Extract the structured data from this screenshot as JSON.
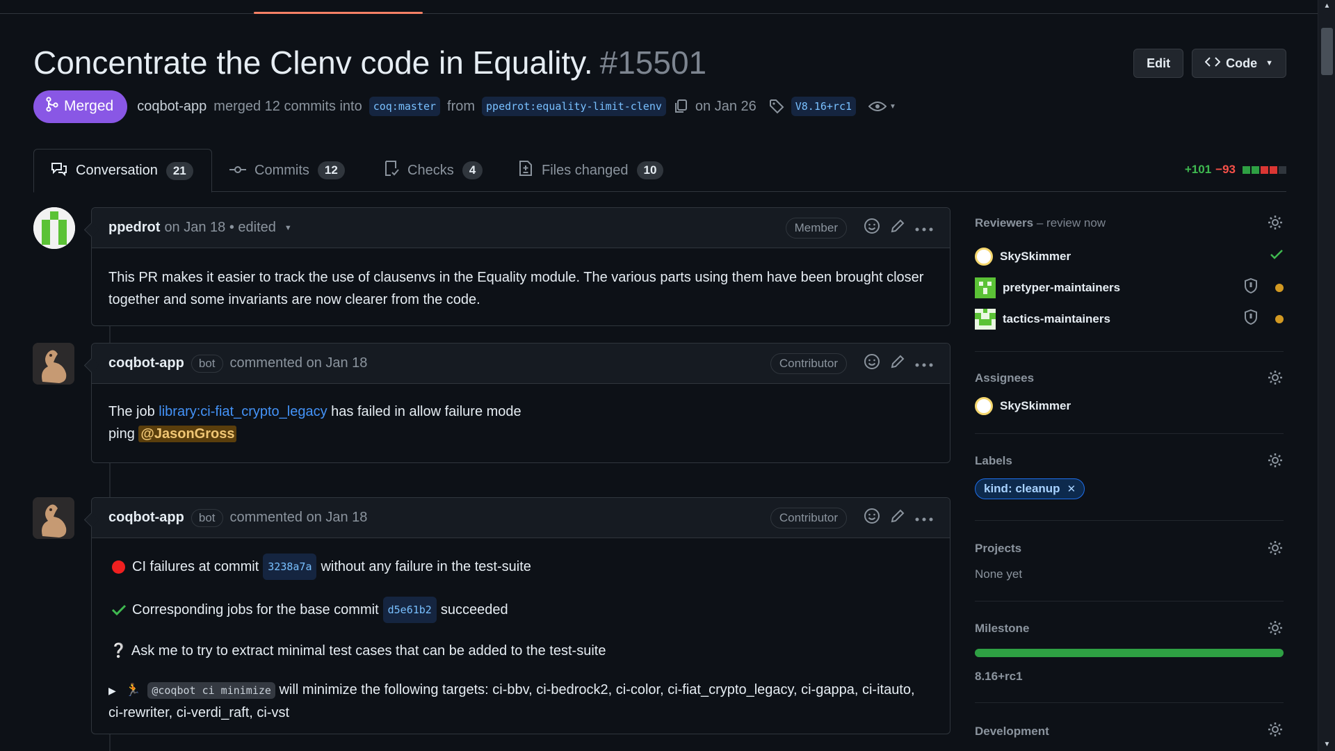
{
  "header": {
    "title": "Concentrate the Clenv code in Equality.",
    "number": "#15501",
    "edit_label": "Edit",
    "code_label": "Code"
  },
  "meta": {
    "status": "Merged",
    "author": "coqbot-app",
    "action": "merged 12 commits into",
    "base_branch": "coq:master",
    "from_word": "from",
    "head_branch": "ppedrot:equality-limit-clenv",
    "date": "on Jan 26",
    "tag": "V8.16+rc1"
  },
  "tabs": [
    {
      "label": "Conversation",
      "count": "21"
    },
    {
      "label": "Commits",
      "count": "12"
    },
    {
      "label": "Checks",
      "count": "4"
    },
    {
      "label": "Files changed",
      "count": "10"
    }
  ],
  "diffstat": {
    "additions": "+101",
    "deletions": "−93"
  },
  "comments": [
    {
      "author": "ppedrot",
      "meta": "on Jan 18 • edited",
      "role": "Member",
      "body": "This PR makes it easier to track the use of clausenvs in the Equality module. The various parts using them have been brought closer together and some invariants are now clearer from the code."
    },
    {
      "author": "coqbot-app",
      "bot_tag": "bot",
      "meta": "commented on Jan 18",
      "role": "Contributor",
      "text_pre": "The job",
      "link": "library:ci-fiat_crypto_legacy",
      "text_post": "has failed in allow failure mode",
      "ping_word": "ping",
      "mention": "@JasonGross"
    },
    {
      "author": "coqbot-app",
      "bot_tag": "bot",
      "meta": "commented on Jan 18",
      "role": "Contributor",
      "line1_pre": "CI failures at commit",
      "line1_sha": "3238a7a",
      "line1_post": "without any failure in the test-suite",
      "line2_pre": "Corresponding jobs for the base commit",
      "line2_sha": "d5e61b2",
      "line2_post": "succeeded",
      "line3_mark": "❔",
      "line3": "Ask me to try to extract minimal test cases that can be added to the test-suite",
      "line4_code": "@coqbot ci minimize",
      "line4_post": "will minimize the following targets: ci-bbv, ci-bedrock2, ci-color, ci-fiat_crypto_legacy, ci-gappa, ci-itauto, ci-rewriter, ci-verdi_raft, ci-vst"
    }
  ],
  "sidebar": {
    "reviewers_title": "Reviewers",
    "reviewers_sub": "– review now",
    "reviewers": [
      {
        "name": "SkySkimmer"
      },
      {
        "name": "pretyper-maintainers"
      },
      {
        "name": "tactics-maintainers"
      }
    ],
    "assignees_title": "Assignees",
    "assignee": "SkySkimmer",
    "labels_title": "Labels",
    "label": "kind: cleanup",
    "projects_title": "Projects",
    "projects_value": "None yet",
    "milestone_title": "Milestone",
    "milestone_progress": 1.0,
    "milestone_value": "8.16+rc1",
    "development_title": "Development"
  },
  "colors": {
    "merged": "#8957e5",
    "link": "#4493f8",
    "addition": "#3fb950",
    "deletion": "#f85149"
  }
}
